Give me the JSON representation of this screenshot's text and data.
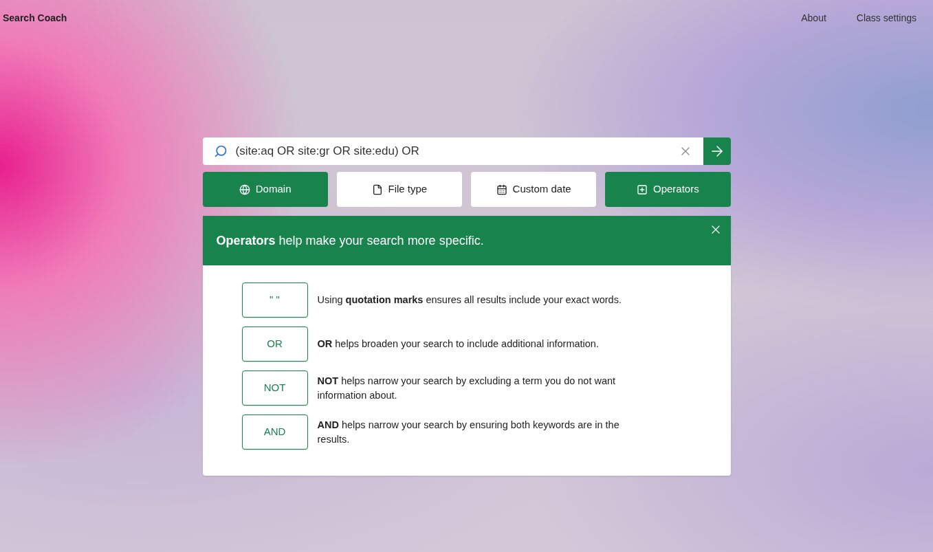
{
  "header": {
    "title": "Search Coach",
    "links": [
      "About",
      "Class settings"
    ]
  },
  "search": {
    "value": "(site:aq OR site:gr OR site:edu) OR"
  },
  "filters": [
    {
      "kind": "domain",
      "label": "Domain",
      "selected": true
    },
    {
      "kind": "file",
      "label": "File type",
      "selected": false
    },
    {
      "kind": "date",
      "label": "Custom date",
      "selected": false
    },
    {
      "kind": "operators",
      "label": "Operators",
      "selected": true
    }
  ],
  "panel": {
    "heading": "**Operators** help make your search more specific.",
    "operators": [
      {
        "key": "\" \"",
        "text": "Using **quotation marks** ensures all results include your exact words."
      },
      {
        "key": "OR",
        "text": "**OR** helps broaden your search to include additional information."
      },
      {
        "key": "NOT",
        "text": "**NOT** helps narrow your search by excluding a term you do not want information about."
      },
      {
        "key": "AND",
        "text": "**AND** helps narrow your search by ensuring both keywords are in the results."
      }
    ]
  }
}
